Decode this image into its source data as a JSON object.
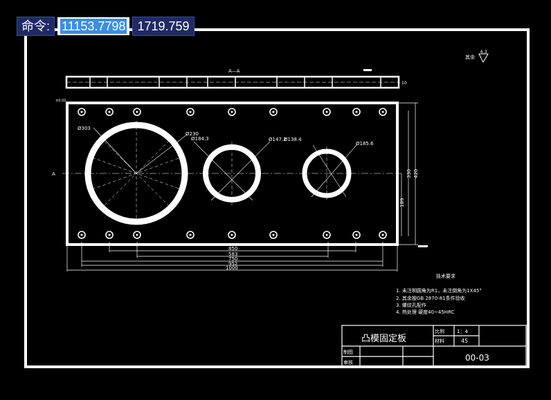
{
  "command": {
    "label": "命令:",
    "x_value": "11153.7798",
    "y_value": "1719.759"
  },
  "drawing": {
    "section_label": "A—A",
    "side_marker_left": "A",
    "surface_note": "其余",
    "surface_symbol": "6.3",
    "dimensions": {
      "d303": "Ø303",
      "d230": "Ø230",
      "d184": "Ø184.3",
      "d147": "Ø147.2",
      "d138": "Ø138.4",
      "d185": "Ø185.6",
      "w850": "850",
      "w583": "583",
      "w750": "750",
      "w952": "952",
      "w1000": "1000",
      "h420": "420",
      "h330": "330",
      "h189": "189"
    },
    "tech_title": "技术要求",
    "tech_notes": [
      "1. 未注明圆角为R1，未注倒角为1X45°",
      "2. 其余按GB 2870-81条件验收",
      "3. 螺纹孔配作",
      "4. 热处理 硬度40~45HRC"
    ],
    "title_block": {
      "part_name": "凸模固定板",
      "scale_label": "比例",
      "scale_value": "1：4",
      "material_label": "材料",
      "material_value": "45",
      "drawn_label": "制图",
      "check_label": "审核",
      "drawing_number": "00-03"
    }
  },
  "colors": {
    "background": "#000000",
    "lines": "#ffffff",
    "accent": "#3a8ee6"
  }
}
